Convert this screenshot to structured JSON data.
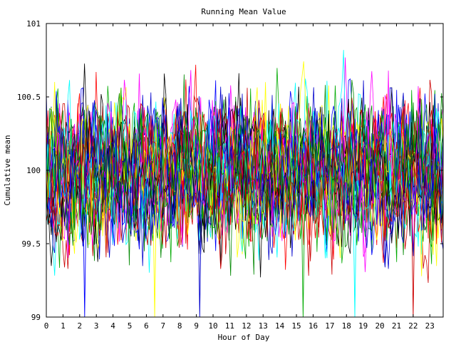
{
  "chart_data": {
    "type": "line",
    "title": "Running Mean Value",
    "xlabel": "Hour of Day",
    "ylabel": "Cumulative mean",
    "xlim": [
      0,
      23.8
    ],
    "ylim": [
      99,
      101
    ],
    "x_ticks": [
      0,
      1,
      2,
      3,
      4,
      5,
      6,
      7,
      8,
      9,
      10,
      11,
      12,
      13,
      14,
      15,
      16,
      17,
      18,
      19,
      20,
      21,
      22,
      23
    ],
    "x_tick_labels": [
      "0",
      "1",
      "2",
      "3",
      "4",
      "5",
      "6",
      "7",
      "8",
      "9",
      "10",
      "11",
      "12",
      "13",
      "14",
      "15",
      "16",
      "17",
      "18",
      "19",
      "20",
      "21",
      "22",
      "23"
    ],
    "y_ticks": [
      99,
      99.5,
      100,
      100.5,
      101
    ],
    "y_tick_labels": [
      "99",
      "99.5",
      "100",
      "100.5",
      "101"
    ],
    "grid": false,
    "legend": "none",
    "series_colors": [
      "#ff0000",
      "#00aa00",
      "#0000ff",
      "#ff00ff",
      "#00ffff",
      "#ffff00",
      "#000000",
      "#cc0000",
      "#0000cc",
      "#008800"
    ],
    "series_count": 30,
    "points_per_series": 240,
    "typical_band": [
      99.6,
      100.4
    ],
    "approx_extremes": {
      "max": 100.82,
      "min_visible": 99.2,
      "spikes_to_axis_bottom_at_hours": [
        2.3,
        6.5,
        9.2,
        15.4,
        18.5,
        22.0
      ]
    }
  }
}
